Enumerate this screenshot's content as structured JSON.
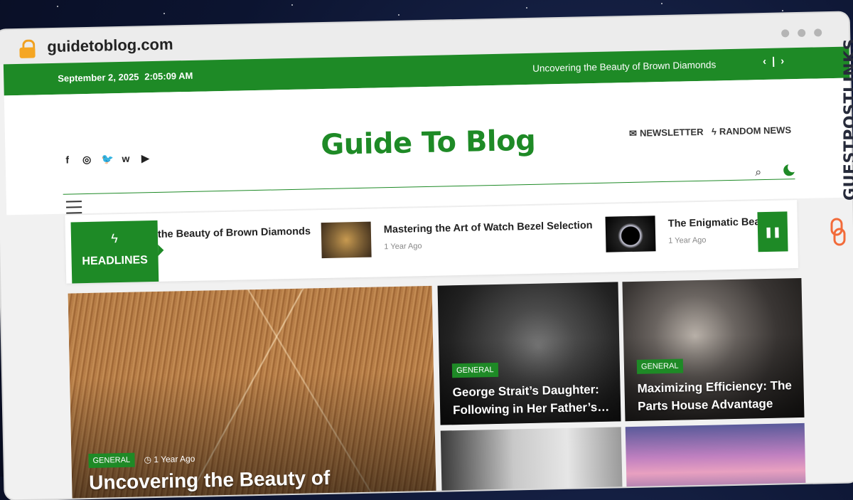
{
  "browser": {
    "url": "guidetoblog.com"
  },
  "topbar": {
    "date": "September 2, 2025",
    "time": "2:05:09 AM",
    "ticker": "Uncovering the Beauty of Brown Diamonds",
    "prev_label": "‹",
    "sep": "|",
    "next_label": "›"
  },
  "header": {
    "site_title": "Guide To Blog",
    "newsletter_label": "NEWSLETTER",
    "random_news_label": "RANDOM NEWS"
  },
  "headlines": {
    "label": "HEADLINES",
    "items": [
      {
        "title": "the Beauty of Brown Diamonds"
      },
      {
        "title": "Mastering the Art of Watch Bezel Selection",
        "ago": "1 Year Ago"
      },
      {
        "title": "The Enigmatic Beau",
        "ago": "1 Year Ago"
      }
    ]
  },
  "cards": {
    "main": {
      "category": "GENERAL",
      "ago": "1 Year Ago",
      "title": "Uncovering the Beauty of"
    },
    "card2": {
      "category": "GENERAL",
      "title": "George Strait’s Daughter: Following in Her Father’s…"
    },
    "card3": {
      "category": "GENERAL",
      "title": "Maximizing Efficiency: The Parts House Advantage"
    }
  },
  "brand_watermark": {
    "text": "GUESTPOSTLINKS"
  },
  "colors": {
    "accent": "#1e8a26",
    "text": "#222222"
  }
}
